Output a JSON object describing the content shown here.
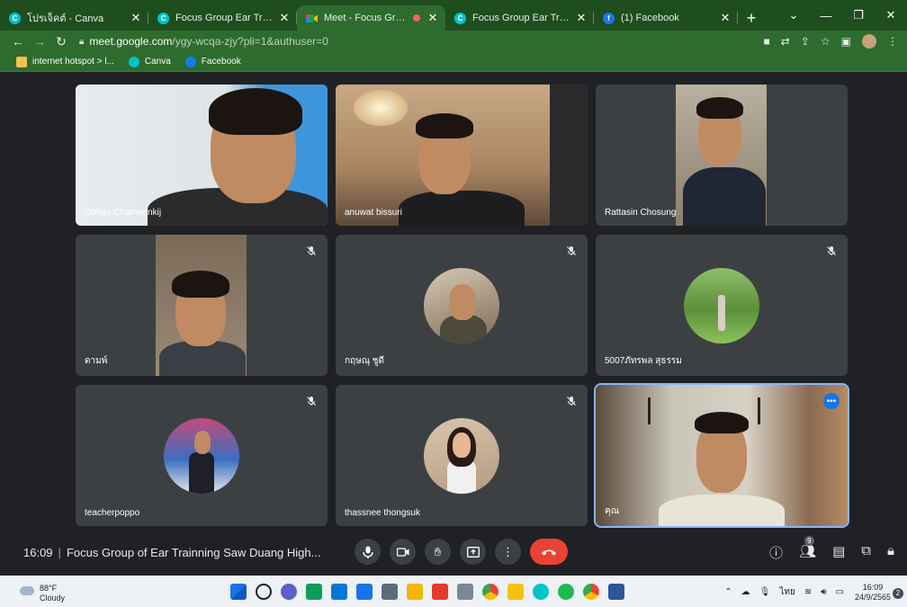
{
  "browser": {
    "tabs": [
      {
        "title": "โปรเจ็คต์ - Canva",
        "icon": "canva-icon",
        "active": false
      },
      {
        "title": "Focus Group Ear Trainning - ",
        "icon": "canva-icon",
        "active": false
      },
      {
        "title": "Meet - Focus Group of E",
        "icon": "meet-icon",
        "active": true
      },
      {
        "title": "Focus Group Ear Trainning",
        "icon": "canva-icon",
        "active": false
      },
      {
        "title": "(1) Facebook",
        "icon": "facebook-icon",
        "active": false
      }
    ],
    "close_glyph": "✕",
    "new_tab_glyph": "+",
    "url_host": "meet.google.com",
    "url_path": "/ygy-wcqa-zjy?pli=1&authuser=0",
    "bookmarks": [
      "internet hotspot > l...",
      "Canva",
      "Facebook"
    ]
  },
  "meet": {
    "participants": [
      {
        "name": "Ophas Chamnankij",
        "camera": true,
        "muted": false
      },
      {
        "name": "anuwat bissuri",
        "camera": true,
        "muted": false
      },
      {
        "name": "Rattasin Chosung",
        "camera": true,
        "muted": false
      },
      {
        "name": "ดามพ์",
        "camera": true,
        "muted": true
      },
      {
        "name": "กฤษณุ ชูดี",
        "camera": false,
        "muted": true
      },
      {
        "name": "5007ภัทรพล สุธรรม",
        "camera": false,
        "muted": true
      },
      {
        "name": "teacherpoppo",
        "camera": false,
        "muted": true
      },
      {
        "name": "thassnee thongsuk",
        "camera": false,
        "muted": true
      },
      {
        "name": "คุณ",
        "camera": true,
        "muted": false
      }
    ],
    "time": "16:09",
    "meeting_title": "Focus Group of Ear Trainning Saw Duang High...",
    "people_count": "9"
  },
  "taskbar": {
    "weather_temp": "88°F",
    "weather_desc": "Cloudy",
    "clock_time": "16:09",
    "clock_date": "24/9/2565",
    "lang": "ไทย",
    "notifications": "2"
  },
  "colors": {
    "chrome_frame": "#1e4d1e",
    "chrome_toolbar": "#2e6b2e",
    "meet_bg": "#202124",
    "tile_bg": "#3c4043",
    "end_call": "#ea4335",
    "active_border": "#8ab4f8"
  }
}
